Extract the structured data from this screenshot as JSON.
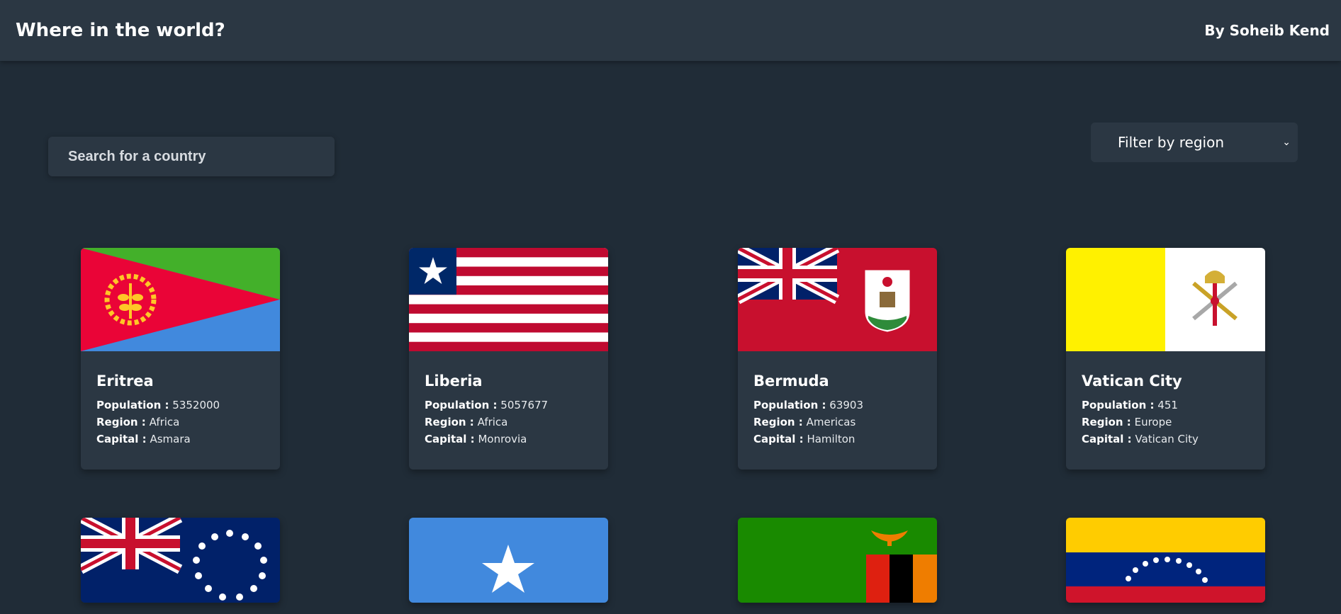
{
  "header": {
    "title": "Where in the world?",
    "author": "By Soheib Kend"
  },
  "search": {
    "placeholder": "Search for a country"
  },
  "filter": {
    "label": "Filter by region"
  },
  "labels": {
    "population": "Population :",
    "region": "Region :",
    "capital": "Capital :"
  },
  "countries": [
    {
      "name": "Eritrea",
      "population": "5352000",
      "region": "Africa",
      "capital": "Asmara"
    },
    {
      "name": "Liberia",
      "population": "5057677",
      "region": "Africa",
      "capital": "Monrovia"
    },
    {
      "name": "Bermuda",
      "population": "63903",
      "region": "Americas",
      "capital": "Hamilton"
    },
    {
      "name": "Vatican City",
      "population": "451",
      "region": "Europe",
      "capital": "Vatican City"
    }
  ],
  "colors": {
    "background": "#202c37",
    "element": "#2b3743",
    "text": "#ffffff"
  }
}
